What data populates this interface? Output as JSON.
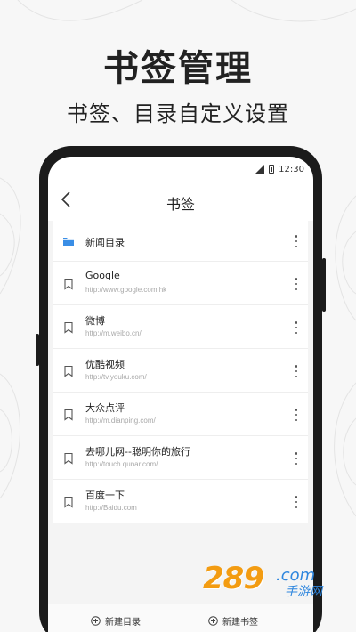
{
  "promo": {
    "title": "书签管理",
    "subtitle": "书签、目录自定义设置"
  },
  "status_bar": {
    "time": "12:30"
  },
  "nav": {
    "title": "书签",
    "back_icon": "chevron-left-icon"
  },
  "folder": {
    "label": "新闻目录",
    "icon": "folder-icon",
    "icon_color": "#3a8ee6"
  },
  "bookmarks": [
    {
      "title": "Google",
      "url": "http://www.google.com.hk"
    },
    {
      "title": "微博",
      "url": "http://m.weibo.cn/"
    },
    {
      "title": "优酷视频",
      "url": "http://tv.youku.com/"
    },
    {
      "title": "大众点评",
      "url": "http://m.dianping.com/"
    },
    {
      "title": "去哪儿网--聪明你的旅行",
      "url": "http://touch.qunar.com/"
    },
    {
      "title": "百度一下",
      "url": "http://Baidu.com"
    }
  ],
  "bottom_bar": {
    "new_folder_label": "新建目录",
    "new_bookmark_label": "新建书签"
  },
  "watermark": {
    "brand": "289",
    "domain": ".com",
    "sub": "手游网"
  },
  "colors": {
    "accent": "#3a8ee6",
    "watermark_orange": "#f39c12",
    "watermark_blue": "#2e86de"
  }
}
